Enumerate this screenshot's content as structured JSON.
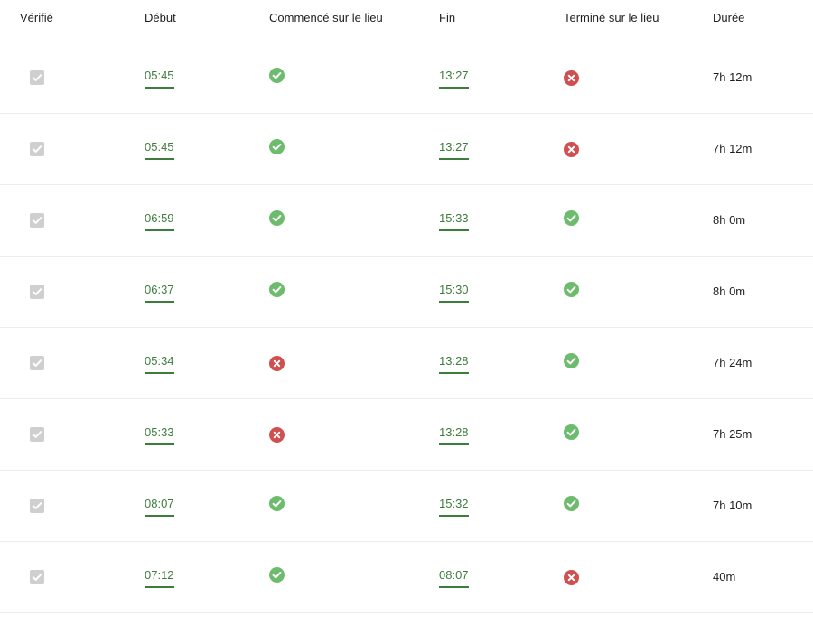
{
  "headers": {
    "verified": "Vérifié",
    "start": "Début",
    "start_on_site": "Commencé sur le lieu",
    "end": "Fin",
    "end_on_site": "Terminé sur le lieu",
    "duration": "Durée"
  },
  "colors": {
    "link_green": "#3c7d3c",
    "ok_green": "#6dbb6d",
    "error_red": "#d05050",
    "checkbox_gray": "#cfcfcf"
  },
  "rows": [
    {
      "verified": true,
      "start": "05:45",
      "start_on_site": "check-icon",
      "end": "13:27",
      "end_on_site": "x-icon",
      "duration": "7h 12m"
    },
    {
      "verified": true,
      "start": "05:45",
      "start_on_site": "check-icon",
      "end": "13:27",
      "end_on_site": "x-icon",
      "duration": "7h 12m"
    },
    {
      "verified": true,
      "start": "06:59",
      "start_on_site": "check-icon",
      "end": "15:33",
      "end_on_site": "check-icon",
      "duration": "8h 0m"
    },
    {
      "verified": true,
      "start": "06:37",
      "start_on_site": "check-icon",
      "end": "15:30",
      "end_on_site": "check-icon",
      "duration": "8h 0m"
    },
    {
      "verified": true,
      "start": "05:34",
      "start_on_site": "x-icon",
      "end": "13:28",
      "end_on_site": "check-icon",
      "duration": "7h 24m"
    },
    {
      "verified": true,
      "start": "05:33",
      "start_on_site": "x-icon",
      "end": "13:28",
      "end_on_site": "check-icon",
      "duration": "7h 25m"
    },
    {
      "verified": true,
      "start": "08:07",
      "start_on_site": "check-icon",
      "end": "15:32",
      "end_on_site": "check-icon",
      "duration": "7h 10m"
    },
    {
      "verified": true,
      "start": "07:12",
      "start_on_site": "check-icon",
      "end": "08:07",
      "end_on_site": "x-icon",
      "duration": "40m"
    }
  ]
}
